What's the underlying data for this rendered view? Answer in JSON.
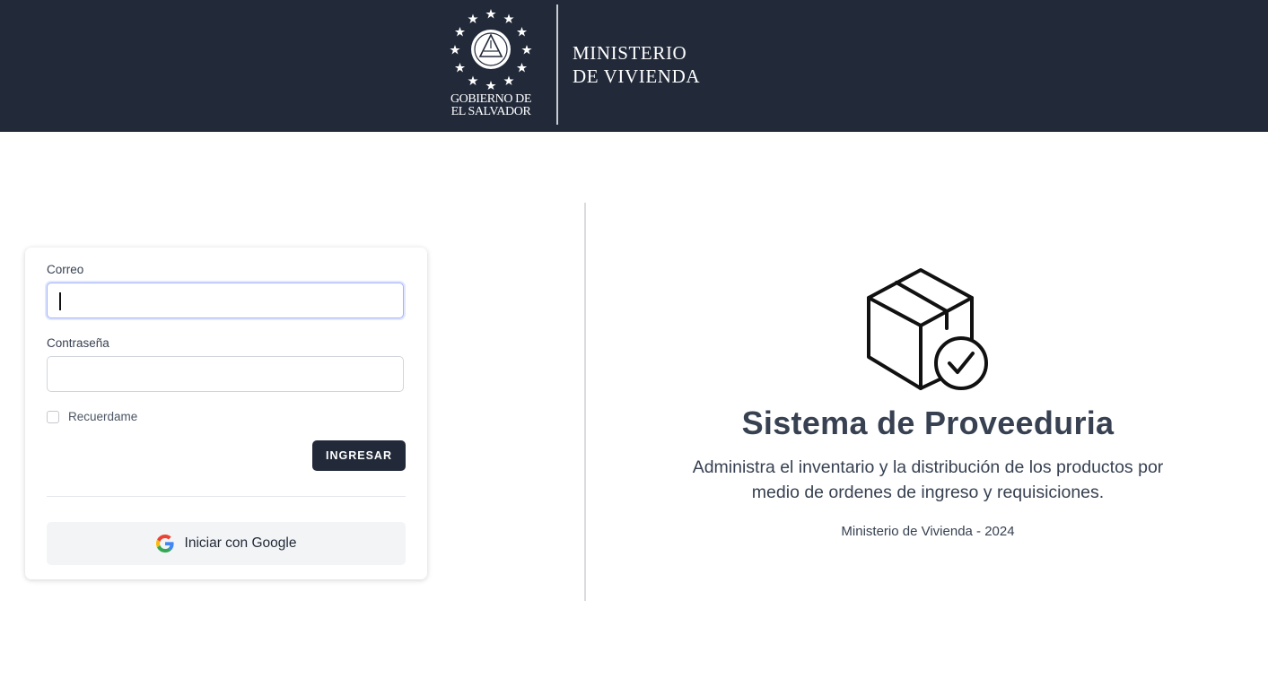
{
  "header": {
    "gov_line1": "GOBIERNO DE",
    "gov_line2": "EL SALVADOR",
    "ministry_line1": "MINISTERIO",
    "ministry_line2": "DE  VIVIENDA",
    "background_color": "#222a3a"
  },
  "login": {
    "email_label": "Correo",
    "email_value": "",
    "password_label": "Contraseña",
    "password_value": "",
    "remember_label": "Recuerdame",
    "remember_checked": false,
    "submit_label": "INGRESAR",
    "google_label": "Iniciar con Google",
    "google_icon": "google-icon"
  },
  "hero": {
    "icon": "package-check-icon",
    "title": "Sistema de Proveeduria",
    "description_line1": "Administra el inventario y la distribución de los productos por",
    "description_line2": "medio de ordenes de ingreso y requisiciones.",
    "footer": "Ministerio de Vivienda - 2024"
  }
}
